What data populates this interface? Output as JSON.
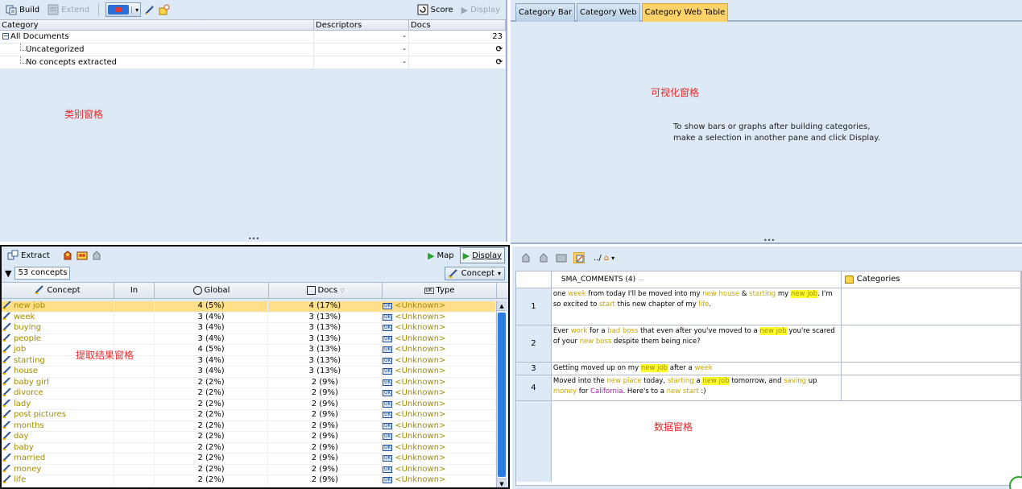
{
  "category_pane": {
    "toolbar": {
      "build_label": "Build",
      "extend_label": "Extend",
      "score_label": "Score",
      "display_label": "Display"
    },
    "columns": [
      "Category",
      "Descriptors",
      "Docs"
    ],
    "rows": [
      {
        "category": "All Documents",
        "descriptors": "-",
        "docs": "23"
      },
      {
        "category": "Uncategorized",
        "descriptors": "-",
        "docs": "⟳"
      },
      {
        "category": "No concepts extracted",
        "descriptors": "-",
        "docs": "⟳"
      }
    ],
    "annotation": "类别窗格"
  },
  "viz_pane": {
    "tabs": [
      "Category Bar",
      "Category Web",
      "Category Web Table"
    ],
    "active_tab": "Category Web Table",
    "annotation": "可视化窗格",
    "message_line1": "To show bars or graphs after building categories,",
    "message_line2": "make a selection in another pane and click Display."
  },
  "extraction_pane": {
    "toolbar": {
      "extract_label": "Extract",
      "map_label": "Map",
      "display_label": "Display"
    },
    "concept_count": "53 concepts",
    "view_combo": "Concept",
    "columns": {
      "concept": "Concept",
      "in": "In",
      "global": "Global",
      "docs": "Docs",
      "type": "Type"
    },
    "annotation": "提取结果窗格",
    "rows": [
      {
        "concept": "new job",
        "global": "4 (5%)",
        "docs": "4 (17%)",
        "type": "<Unknown>"
      },
      {
        "concept": "week",
        "global": "3 (4%)",
        "docs": "3 (13%)",
        "type": "<Unknown>"
      },
      {
        "concept": "buying",
        "global": "3 (4%)",
        "docs": "3 (13%)",
        "type": "<Unknown>"
      },
      {
        "concept": "people",
        "global": "3 (4%)",
        "docs": "3 (13%)",
        "type": "<Unknown>"
      },
      {
        "concept": "job",
        "global": "4 (5%)",
        "docs": "3 (13%)",
        "type": "<Unknown>"
      },
      {
        "concept": "starting",
        "global": "3 (4%)",
        "docs": "3 (13%)",
        "type": "<Unknown>"
      },
      {
        "concept": "house",
        "global": "3 (4%)",
        "docs": "3 (13%)",
        "type": "<Unknown>"
      },
      {
        "concept": "baby girl",
        "global": "2 (2%)",
        "docs": "2 (9%)",
        "type": "<Unknown>"
      },
      {
        "concept": "divorce",
        "global": "2 (2%)",
        "docs": "2 (9%)",
        "type": "<Unknown>"
      },
      {
        "concept": "lady",
        "global": "2 (2%)",
        "docs": "2 (9%)",
        "type": "<Unknown>"
      },
      {
        "concept": "post pictures",
        "global": "2 (2%)",
        "docs": "2 (9%)",
        "type": "<Unknown>"
      },
      {
        "concept": "months",
        "global": "2 (2%)",
        "docs": "2 (9%)",
        "type": "<Unknown>"
      },
      {
        "concept": "day",
        "global": "2 (2%)",
        "docs": "2 (9%)",
        "type": "<Unknown>"
      },
      {
        "concept": "baby",
        "global": "2 (2%)",
        "docs": "2 (9%)",
        "type": "<Unknown>"
      },
      {
        "concept": "married",
        "global": "2 (2%)",
        "docs": "2 (9%)",
        "type": "<Unknown>"
      },
      {
        "concept": "money",
        "global": "2 (2%)",
        "docs": "2 (9%)",
        "type": "<Unknown>"
      },
      {
        "concept": "life",
        "global": "2 (2%)",
        "docs": "2 (9%)",
        "type": "<Unknown>"
      }
    ]
  },
  "data_pane": {
    "toolbar_path_label": "../",
    "columns": {
      "comments": "SMA_COMMENTS (4)",
      "categories": "Categories"
    },
    "annotation": "数据窗格",
    "rows": [
      {
        "num": "1",
        "segments": [
          {
            "t": "one "
          },
          {
            "t": "week",
            "k": "kw"
          },
          {
            "t": " from today I'll be moved into my "
          },
          {
            "t": "new house",
            "k": "kw"
          },
          {
            "t": " & "
          },
          {
            "t": "starting",
            "k": "kw"
          },
          {
            "t": " my "
          },
          {
            "t": "new job",
            "k": "hl"
          },
          {
            "t": ". I'm so excited to "
          },
          {
            "t": "start",
            "k": "kw"
          },
          {
            "t": " this new chapter of my "
          },
          {
            "t": "life",
            "k": "kw"
          },
          {
            "t": "."
          }
        ]
      },
      {
        "num": "2",
        "segments": [
          {
            "t": "Ever "
          },
          {
            "t": "work",
            "k": "kw"
          },
          {
            "t": " for a "
          },
          {
            "t": "bad boss",
            "k": "kw"
          },
          {
            "t": " that even after you've moved to a "
          },
          {
            "t": "new job",
            "k": "hl"
          },
          {
            "t": " you're scared of your "
          },
          {
            "t": "new boss",
            "k": "kw"
          },
          {
            "t": " despite them being nice?"
          }
        ]
      },
      {
        "num": "3",
        "segments": [
          {
            "t": "Getting moved up on my "
          },
          {
            "t": "new job",
            "k": "hl"
          },
          {
            "t": " after a "
          },
          {
            "t": "week",
            "k": "kw"
          }
        ]
      },
      {
        "num": "4",
        "segments": [
          {
            "t": "Moved into the "
          },
          {
            "t": "new place",
            "k": "kw"
          },
          {
            "t": " today, "
          },
          {
            "t": "starting",
            "k": "kw"
          },
          {
            "t": " a "
          },
          {
            "t": "new job",
            "k": "hl"
          },
          {
            "t": " tomorrow, and "
          },
          {
            "t": "saving",
            "k": "kw"
          },
          {
            "t": " up "
          },
          {
            "t": "money",
            "k": "kw"
          },
          {
            "t": " for "
          },
          {
            "t": "California",
            "k": "purple"
          },
          {
            "t": ". Here's to a "
          },
          {
            "t": "new start",
            "k": "kw"
          },
          {
            "t": " :)"
          }
        ]
      }
    ]
  },
  "colors": {
    "pane_bg": "#dde9f4",
    "annotation": "#e82a2a",
    "keyword": "#c7a800",
    "highlight": "#ffff2e",
    "active_tab": "#ffd36a",
    "selected_row": "#ffdf8a"
  }
}
